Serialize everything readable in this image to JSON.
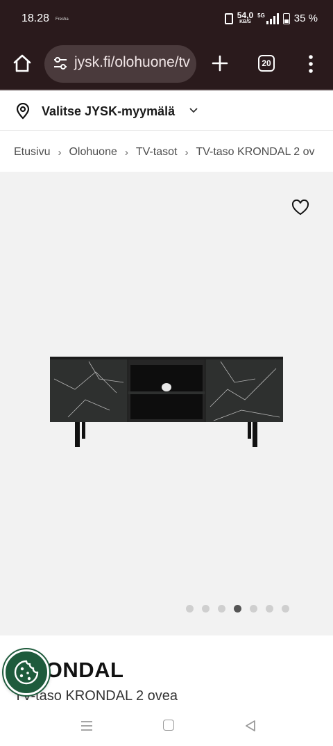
{
  "status_bar": {
    "time": "18.28",
    "app_label": "Fresha",
    "net_speed_value": "54,0",
    "net_speed_unit": "KB/S",
    "network_type": "5G",
    "battery": "35 %"
  },
  "browser": {
    "url": "jysk.fi/olohuone/tv",
    "tab_count": "20",
    "icons": [
      "home-icon",
      "site-settings-icon",
      "plus-icon",
      "tabs-icon",
      "more-vert-icon"
    ]
  },
  "store": {
    "label": "Valitse JYSK-myymälä",
    "icons": [
      "location-pin-icon",
      "chevron-down-icon"
    ]
  },
  "breadcrumb": {
    "items": [
      "Etusivu",
      "Olohuone",
      "TV-tasot",
      "TV-taso KRONDAL 2 ov"
    ],
    "separator": "›"
  },
  "gallery": {
    "image_count": 7,
    "active_index": 3,
    "icons": [
      "heart-outline-icon"
    ]
  },
  "product": {
    "title": "KRONDAL",
    "subtitle": "TV-taso KRONDAL 2 ovea"
  },
  "colors": {
    "browser_chrome": "#2a1a1c",
    "url_pill": "#4a3a3c",
    "cookie_button": "#1e5b3c",
    "image_background": "#f2f2f2",
    "active_dot": "#555555",
    "inactive_dot": "#cfcfcf"
  },
  "nav": {
    "icons": [
      "recent-apps-icon",
      "home-circle-icon",
      "back-icon"
    ]
  }
}
